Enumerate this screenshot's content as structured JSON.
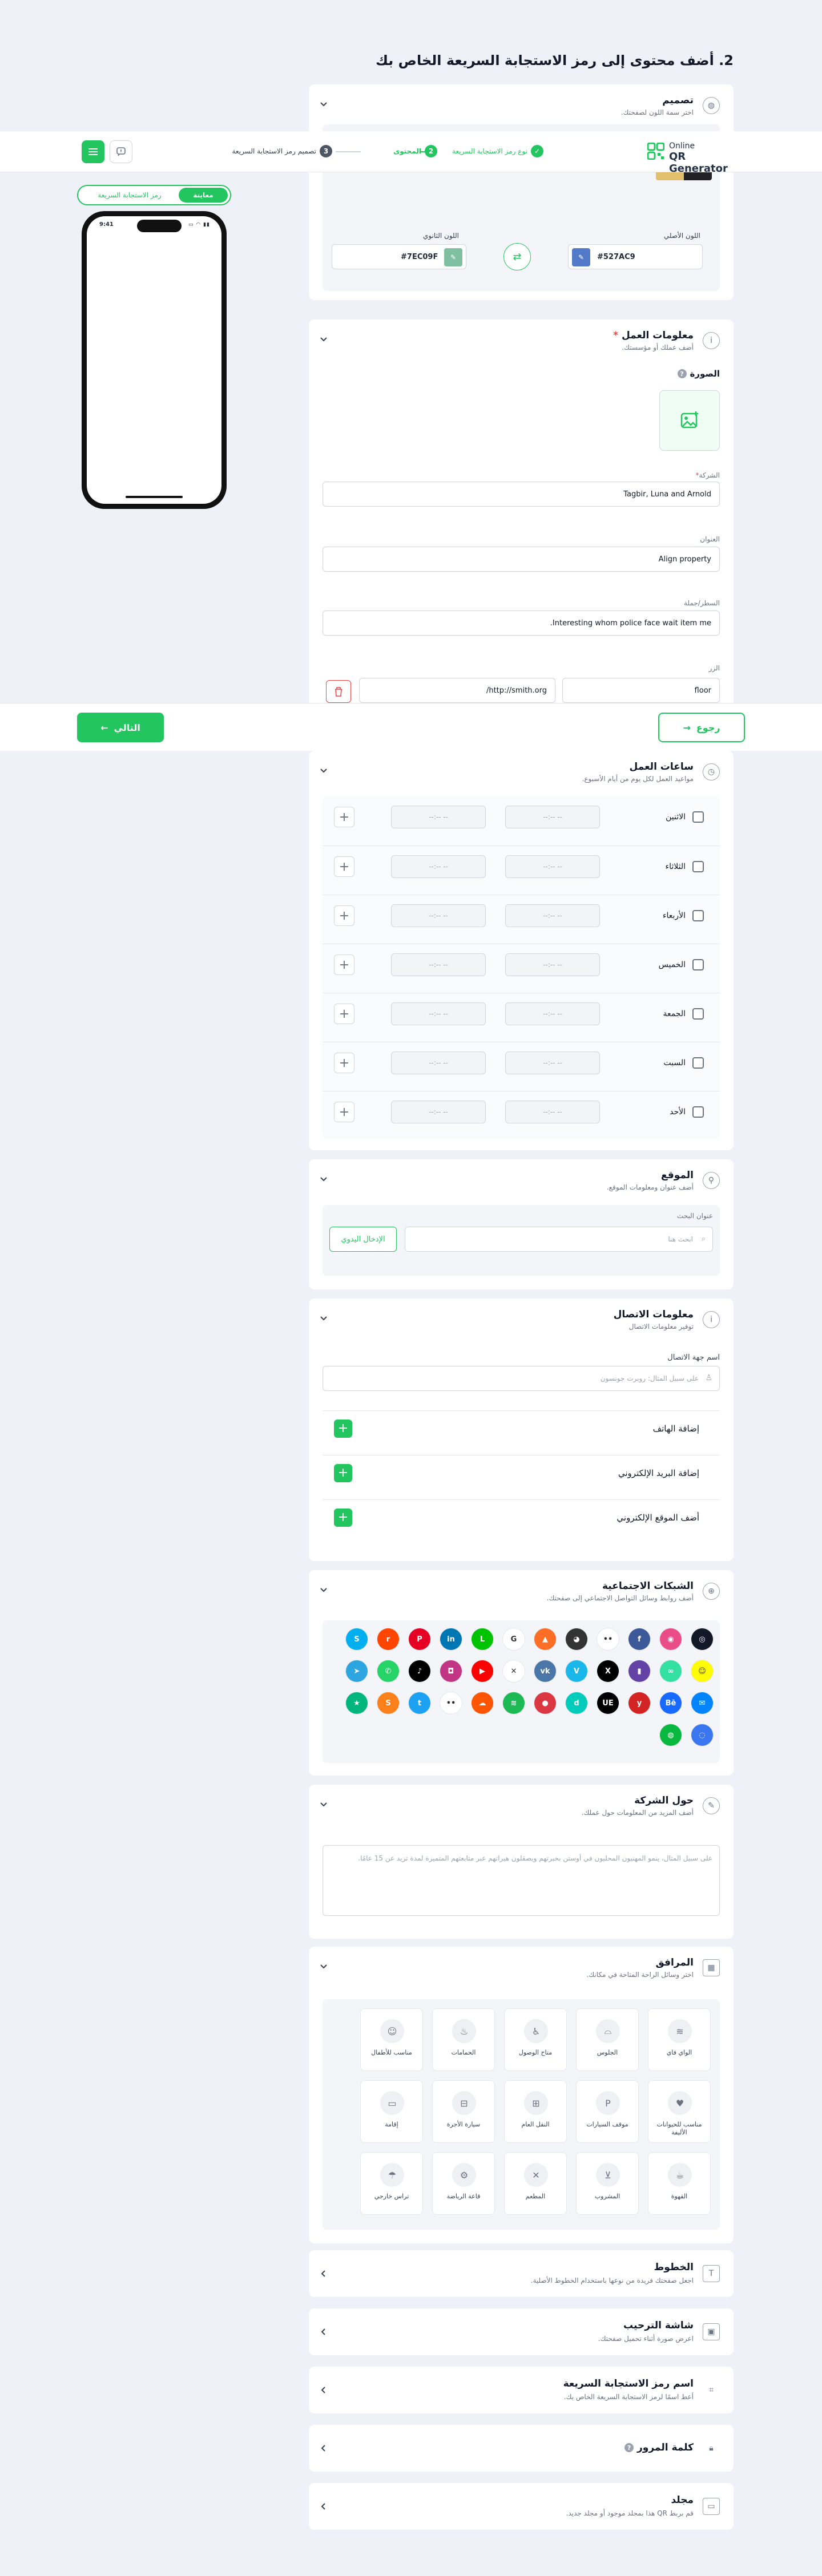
{
  "page_heading": "2. أضف محتوى إلى رمز الاستجابة السريعة الخاص بك",
  "header": {
    "logo_top": "Online",
    "logo_bottom": "QR Generator",
    "steps": [
      {
        "num": "✓",
        "label": "نوع رمز الاستجابة السريعة"
      },
      {
        "num": "2",
        "label": "المحتوى"
      },
      {
        "num": "3",
        "label": "تصميم رمز الاستجابة السريعة"
      }
    ]
  },
  "preview": {
    "tab_preview": "معاينة",
    "tab_qr": "رمز الاستجابة السريعة",
    "time": "9:41"
  },
  "design": {
    "title": "تصميم",
    "subtitle": "اختر سمة اللون لصفحتك.",
    "primary_label": "اللون الأصلي",
    "primary_value": "#527AC9",
    "secondary_label": "اللون الثانوي",
    "secondary_value": "#7EC09F",
    "palette": [
      [
        "#527AC9",
        "#7EC09F"
      ],
      [
        "#333333",
        "#f1f1f1"
      ],
      [
        "#4f7fcf",
        "#d8e4f8"
      ],
      [
        "#222222",
        "#b8a4e3"
      ],
      [
        "#222222",
        "#8dc99d"
      ],
      [
        "#333333",
        "#dddddd"
      ],
      [
        "#222222",
        "#e2bf6a"
      ]
    ]
  },
  "business": {
    "title": "معلومات العمل",
    "subtitle": "أضف عملك أو مؤسستك.",
    "image_label": "الصورة",
    "company_label": "الشركة",
    "company_value": "Tagbir, Luna and Arnold",
    "title_label": "العنوان",
    "title_value": "Align property",
    "tagline_label": "السطر/جملة",
    "tagline_value": "Interesting whom police face wait item me.",
    "button_label": "الزر",
    "button_text": "floor",
    "button_url": "http://smith.org/"
  },
  "footer": {
    "back": "رجوع",
    "next": "التالي"
  },
  "hours": {
    "title": "ساعات العمل",
    "subtitle": "مواعيد العمل لكل يوم من أيام الأسبوع.",
    "placeholder": "--:-- --",
    "days": [
      "الاثنين",
      "الثلاثاء",
      "الأربعاء",
      "الخميس",
      "الجمعة",
      "السبت",
      "الأحد"
    ]
  },
  "location": {
    "title": "الموقع",
    "subtitle": "أضف عنوان ومعلومات الموقع.",
    "search_label": "عنوان البحث",
    "search_placeholder": "ابحث هنا",
    "manual_button": "الإدخال اليدوي"
  },
  "contact": {
    "title": "معلومات الاتصال",
    "subtitle": "توفير معلومات الاتصال",
    "name_label": "اسم جهة الاتصال",
    "name_placeholder": "على سبيل المثال: روبرت جونسون",
    "add_phone": "إضافة الهاتف",
    "add_email": "إضافة البريد الإلكتروني",
    "add_website": "أضف الموقع الإلكتروني"
  },
  "social": {
    "title": "الشبكات الاجتماعية",
    "subtitle": "أضف روابط وسائل التواصل الاجتماعي إلى صفحتك.",
    "icons": [
      {
        "n": "web",
        "c": "#111827",
        "g": "◎"
      },
      {
        "n": "dribbble",
        "c": "#ea4c89",
        "g": "◉"
      },
      {
        "n": "facebook",
        "c": "#3b5998",
        "g": "f"
      },
      {
        "n": "flickr",
        "c": "#ffffff",
        "g": "••"
      },
      {
        "n": "github",
        "c": "#333333",
        "g": "◕"
      },
      {
        "n": "gitlab",
        "c": "#fc6d26",
        "g": "▲"
      },
      {
        "n": "google",
        "c": "#ffffff",
        "g": "G"
      },
      {
        "n": "line",
        "c": "#00c300",
        "g": "L"
      },
      {
        "n": "linkedin",
        "c": "#0077b5",
        "g": "in"
      },
      {
        "n": "pinterest",
        "c": "#e60023",
        "g": "P"
      },
      {
        "n": "reddit",
        "c": "#ff4500",
        "g": "r"
      },
      {
        "n": "skype",
        "c": "#00aff0",
        "g": "S"
      },
      {
        "n": "snapchat",
        "c": "#fffc00",
        "g": "☺"
      },
      {
        "n": "tripadvisor",
        "c": "#34e0a1",
        "g": "∞"
      },
      {
        "n": "twitch",
        "c": "#6441a5",
        "g": "▮"
      },
      {
        "n": "x",
        "c": "#000000",
        "g": "X"
      },
      {
        "n": "vimeo",
        "c": "#1ab7ea",
        "g": "V"
      },
      {
        "n": "vk",
        "c": "#4a76a8",
        "g": "vk"
      },
      {
        "n": "xing",
        "c": "#ffffff",
        "g": "✕"
      },
      {
        "n": "youtube",
        "c": "#ff0000",
        "g": "▶"
      },
      {
        "n": "instagram",
        "c": "#c13584",
        "g": "◘"
      },
      {
        "n": "tiktok",
        "c": "#000000",
        "g": "♪"
      },
      {
        "n": "whatsapp",
        "c": "#25d366",
        "g": "✆"
      },
      {
        "n": "telegram",
        "c": "#2ca5e0",
        "g": "➤"
      },
      {
        "n": "messenger",
        "c": "#0084ff",
        "g": "✉"
      },
      {
        "n": "behance",
        "c": "#1769ff",
        "g": "Bē"
      },
      {
        "n": "yelp",
        "c": "#d32323",
        "g": "y"
      },
      {
        "n": "uber-eats",
        "c": "#000000",
        "g": "UE"
      },
      {
        "n": "deliveroo",
        "c": "#00ccbc",
        "g": "d"
      },
      {
        "n": "opentable",
        "c": "#da3743",
        "g": "●"
      },
      {
        "n": "spotify",
        "c": "#1db954",
        "g": "≋"
      },
      {
        "n": "soundcloud",
        "c": "#ff5500",
        "g": "☁"
      },
      {
        "n": "medium",
        "c": "#ffffff",
        "g": "••"
      },
      {
        "n": "twitter",
        "c": "#1da1f2",
        "g": "t"
      },
      {
        "n": "swiggy",
        "c": "#fc8019",
        "g": "S"
      },
      {
        "n": "trustpilot",
        "c": "#00b67a",
        "g": "★"
      },
      {
        "n": "signal",
        "c": "#3a76f0",
        "g": "◌"
      },
      {
        "n": "wechat",
        "c": "#09b83e",
        "g": "◍"
      }
    ]
  },
  "about": {
    "title": "حول الشركة",
    "subtitle": "أضف المزيد من المعلومات حول عملك.",
    "placeholder": "على سبيل المثال، ينمو المهنيون المحليون في أوستن بخبرتهم ويصقلون هيراتهم عبر متابعتهم المتميزة لمدة تزيد عن 15 عامًا."
  },
  "facilities": {
    "title": "المرافق",
    "subtitle": "اختر وسائل الراحة المتاحة في مكانك.",
    "items": [
      "الواي فاي",
      "الجلوس",
      "متاح الوصول",
      "الحمامات",
      "مناسب للأطفال",
      "مناسب للحيوانات الأليفة",
      "موقف السيارات",
      "النقل العام",
      "سيارة الأجرة",
      "إقامة",
      "القهوة",
      "المشروب",
      "المطعم",
      "قاعة الرياضة",
      "تراس خارجي"
    ]
  },
  "fonts": {
    "title": "الخطوط",
    "subtitle": "اجعل صفحتك فريدة من نوعها باستخدام الخطوط الأصلية."
  },
  "welcome": {
    "title": "شاشة الترحيب",
    "subtitle": "اعرض صورة أثناء تحميل صفحتك."
  },
  "qrname": {
    "title": "اسم رمز الاستجابة السريعة",
    "subtitle": "أعط اسمًا لرمز الاستجابة السريعة الخاص بك."
  },
  "password": {
    "title": "كلمة المرور"
  },
  "folder": {
    "title": "مجلد",
    "subtitle": "قم بربط QR هذا بمجلد موجود أو مجلد جديد."
  },
  "colors": {
    "accent": "#22c55e",
    "danger": "#ef4444",
    "text": "#111827",
    "muted": "#6b7280"
  }
}
